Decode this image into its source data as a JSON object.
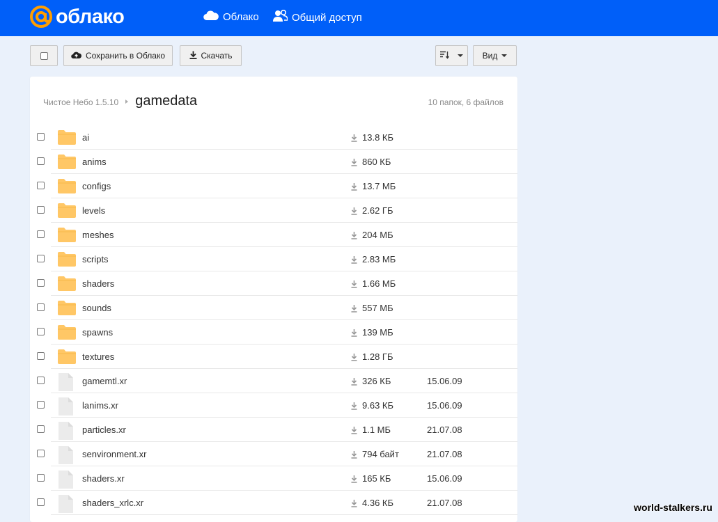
{
  "brand": {
    "logo_text": "облако",
    "accent_color": "#ff9e00",
    "bar_color": "#005ff9"
  },
  "nav": {
    "cloud_label": "Облако",
    "share_label": "Общий доступ"
  },
  "toolbar": {
    "save_label": "Сохранить в Облако",
    "download_label": "Скачать",
    "view_label": "Вид"
  },
  "breadcrumb": {
    "parent": "Чистое Небо 1.5.10",
    "current": "gamedata"
  },
  "counts": "10 папок, 6 файлов",
  "files": [
    {
      "type": "folder",
      "name": "ai",
      "size": "13.8 КБ",
      "date": ""
    },
    {
      "type": "folder",
      "name": "anims",
      "size": "860 КБ",
      "date": ""
    },
    {
      "type": "folder",
      "name": "configs",
      "size": "13.7 МБ",
      "date": ""
    },
    {
      "type": "folder",
      "name": "levels",
      "size": "2.62 ГБ",
      "date": ""
    },
    {
      "type": "folder",
      "name": "meshes",
      "size": "204 МБ",
      "date": ""
    },
    {
      "type": "folder",
      "name": "scripts",
      "size": "2.83 МБ",
      "date": ""
    },
    {
      "type": "folder",
      "name": "shaders",
      "size": "1.66 МБ",
      "date": ""
    },
    {
      "type": "folder",
      "name": "sounds",
      "size": "557 МБ",
      "date": ""
    },
    {
      "type": "folder",
      "name": "spawns",
      "size": "139 МБ",
      "date": ""
    },
    {
      "type": "folder",
      "name": "textures",
      "size": "1.28 ГБ",
      "date": ""
    },
    {
      "type": "file",
      "name": "gamemtl.xr",
      "size": "326 КБ",
      "date": "15.06.09"
    },
    {
      "type": "file",
      "name": "lanims.xr",
      "size": "9.63 КБ",
      "date": "15.06.09"
    },
    {
      "type": "file",
      "name": "particles.xr",
      "size": "1.1 МБ",
      "date": "21.07.08"
    },
    {
      "type": "file",
      "name": "senvironment.xr",
      "size": "794 байт",
      "date": "21.07.08"
    },
    {
      "type": "file",
      "name": "shaders.xr",
      "size": "165 КБ",
      "date": "15.06.09"
    },
    {
      "type": "file",
      "name": "shaders_xrlc.xr",
      "size": "4.36 КБ",
      "date": "21.07.08"
    }
  ],
  "watermark": "world-stalkers.ru"
}
